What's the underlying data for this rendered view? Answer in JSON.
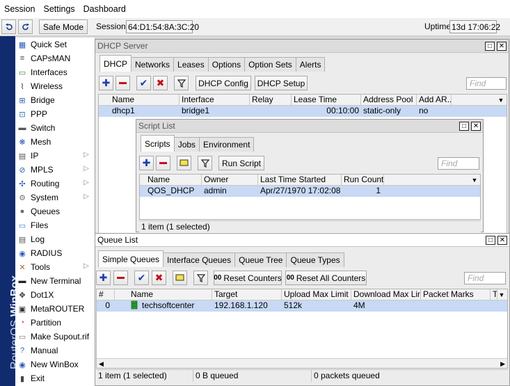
{
  "menubar": {
    "items": [
      "Session",
      "Settings",
      "Dashboard"
    ]
  },
  "toolbar": {
    "safe_mode": "Safe Mode",
    "session_label": "Session:",
    "session_value": "64:D1:54:8A:3C:20",
    "uptime_label": "Uptime:",
    "uptime_value": "13d 17:06:22"
  },
  "brand": {
    "prefix": "RouterOS",
    "name": "WinBox"
  },
  "sidebar": {
    "items": [
      {
        "label": "Quick Set",
        "icon": "quickset-icon"
      },
      {
        "label": "CAPsMAN",
        "icon": "capsman-icon"
      },
      {
        "label": "Interfaces",
        "icon": "interfaces-icon"
      },
      {
        "label": "Wireless",
        "icon": "wireless-icon"
      },
      {
        "label": "Bridge",
        "icon": "bridge-icon"
      },
      {
        "label": "PPP",
        "icon": "ppp-icon"
      },
      {
        "label": "Switch",
        "icon": "switch-icon"
      },
      {
        "label": "Mesh",
        "icon": "mesh-icon"
      },
      {
        "label": "IP",
        "icon": "ip-icon",
        "submenu": true
      },
      {
        "label": "MPLS",
        "icon": "mpls-icon",
        "submenu": true
      },
      {
        "label": "Routing",
        "icon": "routing-icon",
        "submenu": true
      },
      {
        "label": "System",
        "icon": "system-icon",
        "submenu": true
      },
      {
        "label": "Queues",
        "icon": "queues-icon"
      },
      {
        "label": "Files",
        "icon": "files-icon"
      },
      {
        "label": "Log",
        "icon": "log-icon"
      },
      {
        "label": "RADIUS",
        "icon": "radius-icon"
      },
      {
        "label": "Tools",
        "icon": "tools-icon",
        "submenu": true
      },
      {
        "label": "New Terminal",
        "icon": "terminal-icon"
      },
      {
        "label": "Dot1X",
        "icon": "dot1x-icon"
      },
      {
        "label": "MetaROUTER",
        "icon": "metarouter-icon"
      },
      {
        "label": "Partition",
        "icon": "partition-icon"
      },
      {
        "label": "Make Supout.rif",
        "icon": "supout-icon"
      },
      {
        "label": "Manual",
        "icon": "manual-icon"
      },
      {
        "label": "New WinBox",
        "icon": "winbox-icon"
      },
      {
        "label": "Exit",
        "icon": "exit-icon"
      }
    ]
  },
  "dhcp": {
    "title": "DHCP Server",
    "tabs": [
      "DHCP",
      "Networks",
      "Leases",
      "Options",
      "Option Sets",
      "Alerts"
    ],
    "config_btn": "DHCP Config",
    "setup_btn": "DHCP Setup",
    "find": "Find",
    "columns": [
      "Name",
      "Interface",
      "Relay",
      "Lease Time",
      "Address Pool",
      "Add AR..."
    ],
    "row": {
      "name": "dhcp1",
      "interface": "bridge1",
      "relay": "",
      "lease": "00:10:00",
      "pool": "static-only",
      "addar": "no"
    }
  },
  "scripts": {
    "title": "Script List",
    "tabs": [
      "Scripts",
      "Jobs",
      "Environment"
    ],
    "run_btn": "Run Script",
    "find": "Find",
    "columns": [
      "Name",
      "Owner",
      "Last Time Started",
      "Run Count"
    ],
    "row": {
      "name": "QOS_DHCP",
      "owner": "admin",
      "last": "Apr/27/1970 17:02:08",
      "count": "1"
    },
    "status": "1 item (1 selected)"
  },
  "queues": {
    "title": "Queue List",
    "tabs": [
      "Simple Queues",
      "Interface Queues",
      "Queue Tree",
      "Queue Types"
    ],
    "reset_btn": "Reset Counters",
    "reset_all_btn": "Reset All Counters",
    "counter_glyph": "00",
    "find": "Find",
    "columns": [
      "#",
      "Name",
      "Target",
      "Upload Max Limit",
      "Download Max Limit",
      "Packet Marks",
      "T"
    ],
    "row": {
      "num": "0",
      "name": "techsoftcenter",
      "target": "192.168.1.120",
      "upload": "512k",
      "download": "4M",
      "marks": ""
    },
    "status": [
      "1 item (1 selected)",
      "0 B queued",
      "0 packets queued"
    ]
  }
}
